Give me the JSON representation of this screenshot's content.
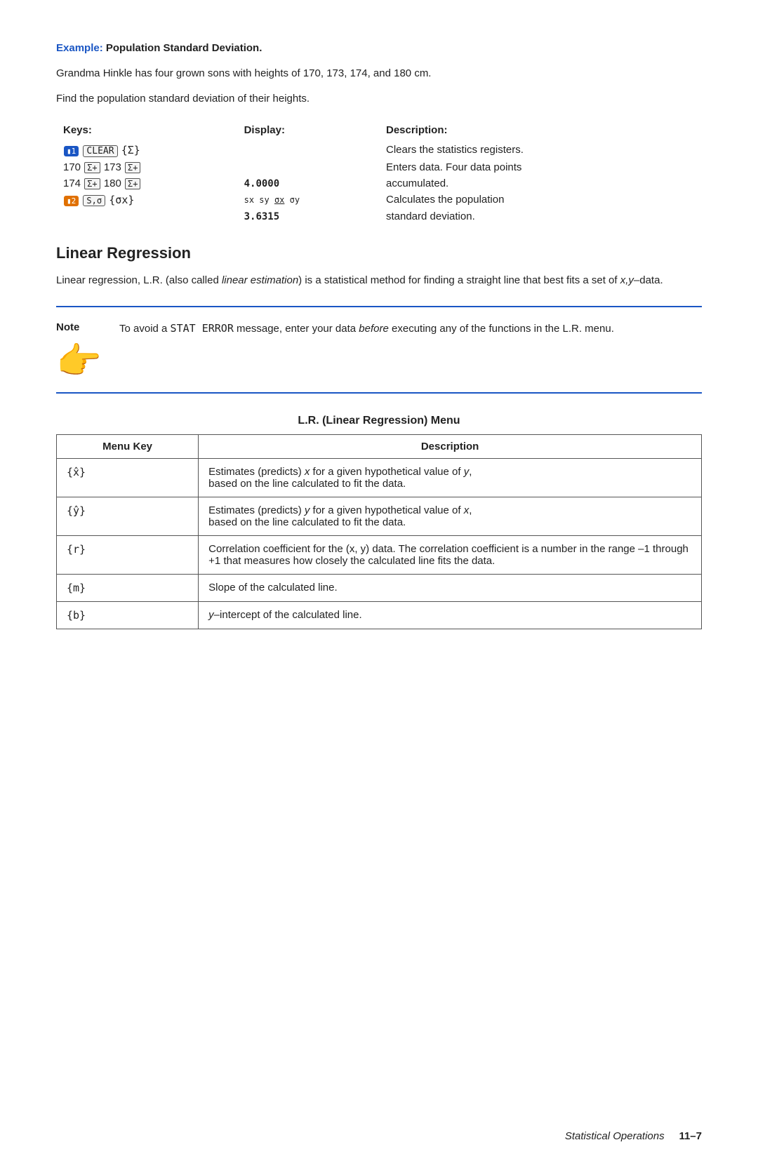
{
  "example": {
    "label": "Example:",
    "title": " Population Standard Deviation.",
    "body_line1": "Grandma Hinkle has four grown sons with heights of 170, 173, 174, and 180 cm.",
    "body_line2": "Find the population standard deviation of their heights.",
    "table": {
      "headers": [
        "Keys:",
        "Display:",
        "Description:"
      ],
      "rows": [
        {
          "keys_html": "key1_clear",
          "display": "",
          "description": "Clears the statistics registers."
        },
        {
          "keys_html": "key2_data",
          "display": "",
          "description": "Enters data. Four data points"
        },
        {
          "keys_html": "key3_data2",
          "display": "4.0000",
          "description": "accumulated."
        },
        {
          "keys_html": "key4_sigma",
          "display": "sx sy σx σy",
          "description": "Calculates the population"
        },
        {
          "keys_html": "",
          "display": "3.6315",
          "description": "standard deviation."
        }
      ]
    }
  },
  "linear_regression": {
    "heading": "Linear Regression",
    "body": "Linear regression, L.R. (also called linear estimation) is a statistical method for finding a straight line that best fits a set of x,y–data.",
    "note": {
      "label": "Note",
      "text_pre": "To avoid a ",
      "code": "STAT ERROR",
      "text_mid": " message, enter your data ",
      "italic": "before",
      "text_post": " executing any of the functions in the L.R. menu."
    },
    "lr_menu": {
      "title": "L.R. (Linear Regression) Menu",
      "headers": [
        "Menu Key",
        "Description"
      ],
      "rows": [
        {
          "key": "{x̂}",
          "description": "Estimates (predicts) x for a given hypothetical value of y, based on the line calculated to fit the data."
        },
        {
          "key": "{ŷ}",
          "description": "Estimates (predicts) y for a given hypothetical value of x, based on the line calculated to fit the data."
        },
        {
          "key": "{r}",
          "description": "Correlation coefficient for the (x, y) data. The correlation coefficient is a number in the range –1 through +1 that measures how closely the calculated line fits the data."
        },
        {
          "key": "{m}",
          "description": "Slope of the calculated line."
        },
        {
          "key": "{b}",
          "description": "y–intercept of the calculated line."
        }
      ]
    }
  },
  "footer": {
    "title": "Statistical Operations",
    "page": "11–7"
  }
}
